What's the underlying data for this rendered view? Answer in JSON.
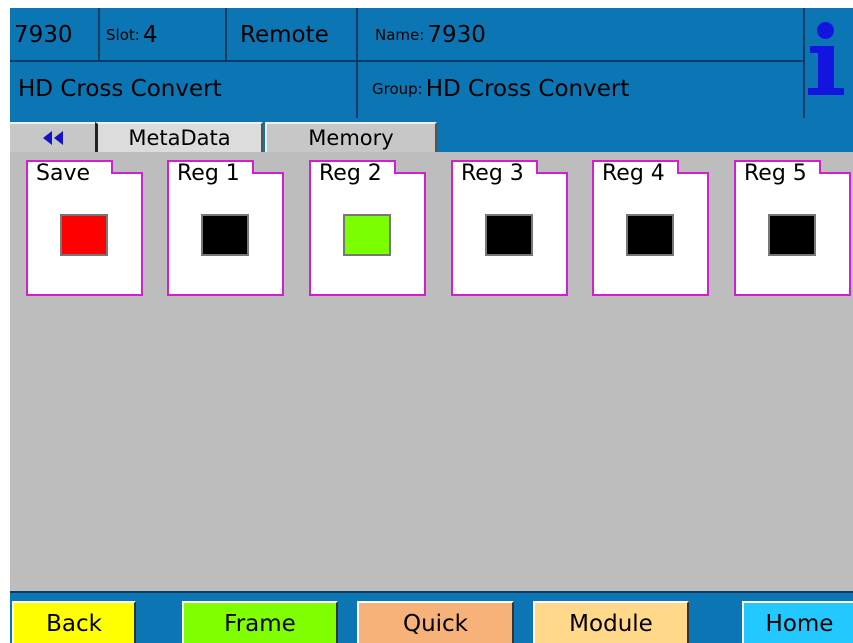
{
  "header": {
    "frame_id": "7930",
    "slot_label": "Slot:",
    "slot_value": "4",
    "mode": "Remote",
    "name_label": "Name:",
    "name_value": "7930",
    "card_type": "HD Cross Convert",
    "group_label": "Group:",
    "group_value": "HD Cross Convert"
  },
  "tabs": [
    {
      "label": "MetaData",
      "active": true
    },
    {
      "label": "Memory",
      "active": false
    }
  ],
  "registers": [
    {
      "label": "Save",
      "color": "#ff0000"
    },
    {
      "label": "Reg 1",
      "color": "#000000"
    },
    {
      "label": "Reg 2",
      "color": "#7bff00"
    },
    {
      "label": "Reg 3",
      "color": "#000000"
    },
    {
      "label": "Reg 4",
      "color": "#000000"
    },
    {
      "label": "Reg 5",
      "color": "#000000"
    }
  ],
  "bottom_buttons": [
    {
      "label": "Back",
      "color": "#ffff00"
    },
    {
      "label": "Frame",
      "color": "#7fff00"
    },
    {
      "label": "Quick",
      "color": "#f7b27a"
    },
    {
      "label": "Module",
      "color": "#ffd88a"
    },
    {
      "label": "Home",
      "color": "#23c8ff"
    }
  ],
  "icons": {
    "back_arrows": "double-left-arrow-icon",
    "info": "info-icon"
  }
}
